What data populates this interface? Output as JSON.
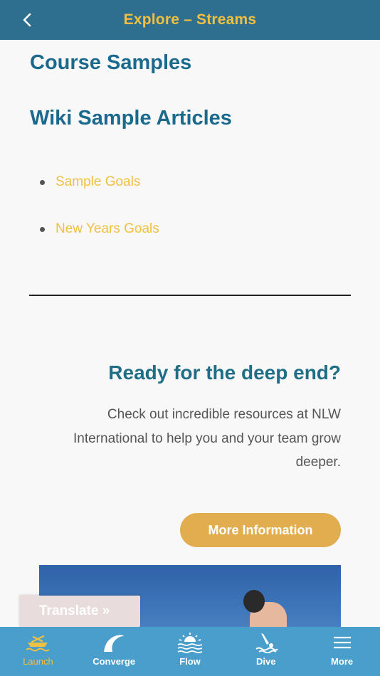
{
  "header": {
    "title": "Explore – Streams"
  },
  "main": {
    "links": {
      "course_samples": "Course Samples",
      "wiki_sample_articles": "Wiki Sample Articles"
    },
    "wiki_items": [
      {
        "label": "Sample Goals"
      },
      {
        "label": "New Years Goals"
      }
    ],
    "cta": {
      "title": "Ready for the deep end?",
      "body": "Check out incredible resources at NLW International to help you and your team grow deeper.",
      "button_label": "More Information"
    }
  },
  "translate": {
    "label": "Translate »"
  },
  "tabbar": {
    "tabs": [
      {
        "label": "Launch",
        "icon": "boat-icon",
        "active": true
      },
      {
        "label": "Converge",
        "icon": "wave-icon",
        "active": false
      },
      {
        "label": "Flow",
        "icon": "sunrise-icon",
        "active": false
      },
      {
        "label": "Dive",
        "icon": "diver-icon",
        "active": false
      },
      {
        "label": "More",
        "icon": "hamburger-icon",
        "active": false
      }
    ]
  },
  "colors": {
    "header_bg": "#2e6e8e",
    "accent_gold": "#f0c040",
    "heading_blue": "#1b6a8e",
    "tabbar_bg": "#4a9ecb",
    "button_gold": "#e2ad4f"
  }
}
